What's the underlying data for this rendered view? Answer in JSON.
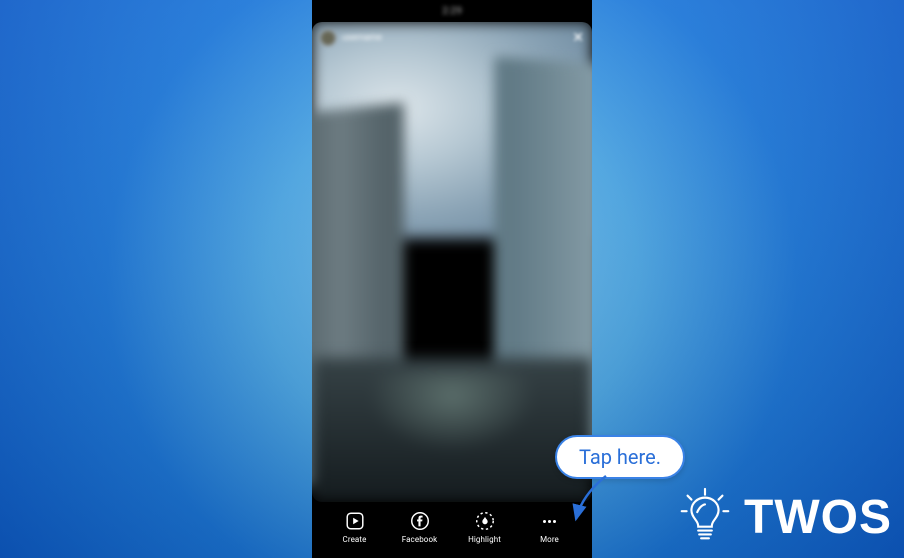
{
  "status_bar": {
    "left": "",
    "center": "2:29",
    "right": ""
  },
  "story": {
    "username": "username",
    "close_glyph": "✕"
  },
  "actions": {
    "create": "Create",
    "facebook": "Facebook",
    "highlight": "Highlight",
    "more": "More"
  },
  "callout": {
    "text": "Tap here."
  },
  "watermark": {
    "brand": "TWOS"
  }
}
